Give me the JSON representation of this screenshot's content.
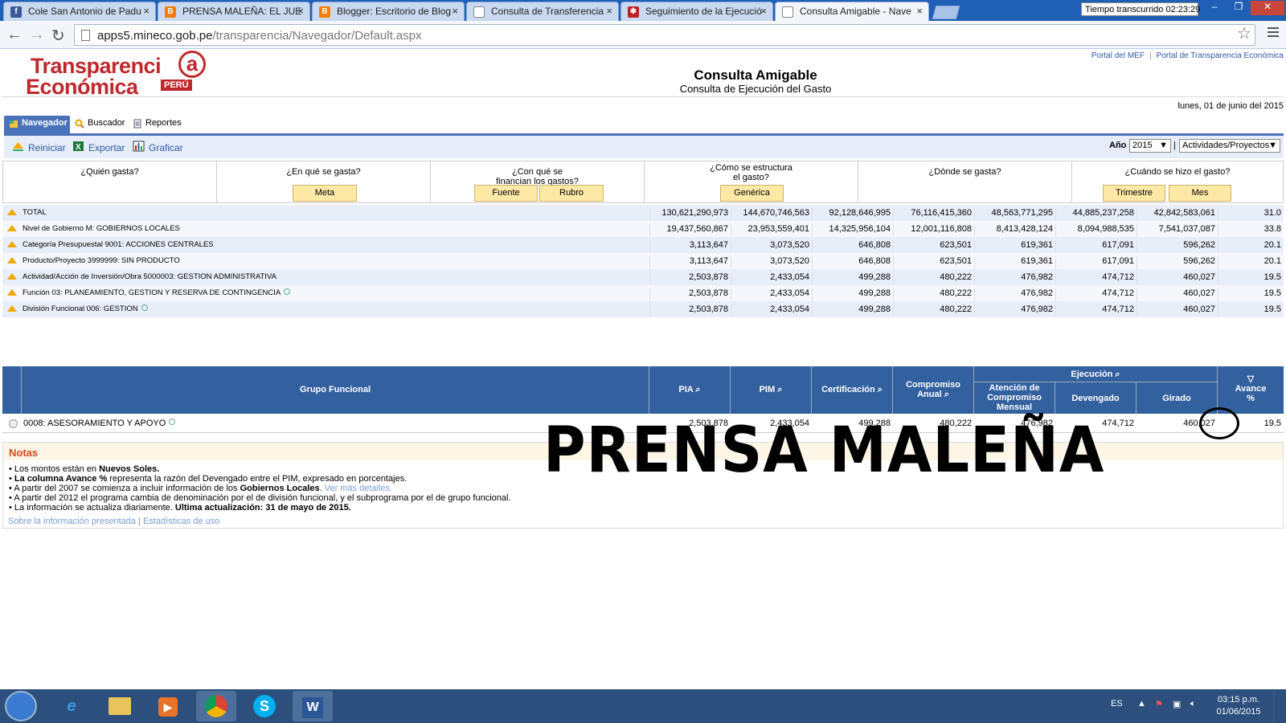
{
  "browser": {
    "tabs": [
      {
        "label": "Cole San Antonio de Padu",
        "icon": "facebook-icon",
        "color": "#3b5998",
        "glyph": "f"
      },
      {
        "label": "PRENSA MALEÑA: EL JUE",
        "icon": "blogger-icon",
        "color": "#f57d00",
        "glyph": "B"
      },
      {
        "label": "Blogger: Escritorio de Blog",
        "icon": "blogger-icon",
        "color": "#f57d00",
        "glyph": "B"
      },
      {
        "label": "Consulta de Transferencia",
        "icon": "page-icon",
        "color": "#ffffff",
        "glyph": ""
      },
      {
        "label": "Seguimiento de la Ejecució",
        "icon": "peru-shield-icon",
        "color": "#b22",
        "glyph": "✱"
      },
      {
        "label": "Consulta Amigable - Nave",
        "icon": "page-icon",
        "color": "#ffffff",
        "glyph": ""
      }
    ],
    "timer": "Tiempo transcurrido 02:23:29",
    "url_host": "apps5.mineco.gob.pe",
    "url_path": "/transparencia/Navegador/Default.aspx"
  },
  "header": {
    "logo_line1": "Transparenci",
    "logo_at": "a",
    "logo_line2": "Económica",
    "logo_badge": "PERÚ",
    "title": "Consulta Amigable",
    "subtitle": "Consulta de Ejecución del Gasto",
    "link_mef": "Portal del MEF",
    "link_portal": "Portal de Transparencia Económica",
    "date": "lunes, 01 de junio del 2015"
  },
  "nav_tabs": [
    "Navegador",
    "Buscador",
    "Reportes"
  ],
  "actions": {
    "reiniciar": "Reiniciar",
    "exportar": "Exportar",
    "graficar": "Graficar",
    "year_label": "Año",
    "year_value": "2015",
    "scope_value": "Actividades/Proyectos"
  },
  "questions": {
    "quien": "¿Quién gasta?",
    "en_que": "¿En qué se gasta?",
    "meta": "Meta",
    "con_que_1": "¿Con qué se",
    "con_que_2": "financian los gastos?",
    "fuente": "Fuente",
    "rubro": "Rubro",
    "como_1": "¿Cómo se estructura",
    "como_2": "el gasto?",
    "generica": "Genérica",
    "donde": "¿Dónde se gasta?",
    "cuando": "¿Cuándo se hizo el gasto?",
    "trimestre": "Trimestre",
    "mes": "Mes"
  },
  "summary_rows": [
    {
      "label": "TOTAL",
      "pin": false,
      "v": [
        "130,621,290,973",
        "144,670,746,563",
        "92,128,646,995",
        "76,116,415,360",
        "48,563,771,295",
        "44,885,237,258",
        "42,842,583,061",
        "31.0"
      ]
    },
    {
      "label": "Nivel de Gobierno M: GOBIERNOS LOCALES",
      "pin": false,
      "v": [
        "19,437,560,867",
        "23,953,559,401",
        "14,325,956,104",
        "12,001,116,808",
        "8,413,428,124",
        "8,094,988,535",
        "7,541,037,087",
        "33.8"
      ]
    },
    {
      "label": "Categoría Presupuestal 9001: ACCIONES CENTRALES",
      "pin": false,
      "v": [
        "3,113,647",
        "3,073,520",
        "646,808",
        "623,501",
        "619,361",
        "617,091",
        "596,262",
        "20.1"
      ]
    },
    {
      "label": "Producto/Proyecto 3999999: SIN PRODUCTO",
      "pin": false,
      "v": [
        "3,113,647",
        "3,073,520",
        "646,808",
        "623,501",
        "619,361",
        "617,091",
        "596,262",
        "20.1"
      ]
    },
    {
      "label": "Actividad/Acción de Inversión/Obra 5000003: GESTION ADMINISTRATIVA",
      "pin": false,
      "v": [
        "2,503,878",
        "2,433,054",
        "499,288",
        "480,222",
        "476,982",
        "474,712",
        "460,027",
        "19.5"
      ]
    },
    {
      "label": "Función 03: PLANEAMIENTO, GESTION Y RESERVA DE CONTINGENCIA",
      "pin": true,
      "v": [
        "2,503,878",
        "2,433,054",
        "499,288",
        "480,222",
        "476,982",
        "474,712",
        "460,027",
        "19.5"
      ]
    },
    {
      "label": "División Funcional 006: GESTION",
      "pin": true,
      "v": [
        "2,503,878",
        "2,433,054",
        "499,288",
        "480,222",
        "476,982",
        "474,712",
        "460,027",
        "19.5"
      ]
    }
  ],
  "table_header": {
    "grupo": "Grupo Funcional",
    "pia": "PIA",
    "pim": "PIM",
    "certificacion": "Certificación",
    "compromiso_1": "Compromiso",
    "compromiso_2": "Anual",
    "ejecucion": "Ejecución",
    "atencion_1": "Atención de",
    "atencion_2": "Compromiso",
    "atencion_3": "Mensual",
    "devengado": "Devengado",
    "girado": "Girado",
    "avance_1": "Avance",
    "avance_2": "%"
  },
  "data_row": {
    "label": "0008: ASESORAMIENTO Y APOYO",
    "v": [
      "2,503,878",
      "2,433,054",
      "499,288",
      "480,222",
      "476,982",
      "474,712",
      "460,027",
      "19.5"
    ]
  },
  "notes": {
    "title": "Notas",
    "l1a": "Los montos están en ",
    "l1b": "Nuevos Soles.",
    "l2a": "La columna Avance %",
    "l2b": " representa la razón del Devengado entre el PIM, expresado en porcentajes.",
    "l3a": "A partir del 2007 se comienza a incluir información de los ",
    "l3b": "Gobiernos Locales",
    "l3c": ". ",
    "l3d": "Ver más detalles.",
    "l4": "A partir del 2012 el programa cambia de denominación por el de división funcional, y el subprograma por el de grupo funcional.",
    "l5a": "La información se actualiza diariamente. ",
    "l5b": "Ultima actualización: 31 de mayo de 2015.",
    "footer_1": "Sobre la información presentada",
    "footer_2": "Estadísticas de uso"
  },
  "watermark": "PRENSA MALEÑA",
  "taskbar": {
    "apps": [
      "ie-icon",
      "explorer-icon",
      "media-player-icon",
      "chrome-icon",
      "skype-icon",
      "word-icon"
    ],
    "lang": "ES",
    "time": "03:15 p.m.",
    "date": "01/06/2015"
  }
}
